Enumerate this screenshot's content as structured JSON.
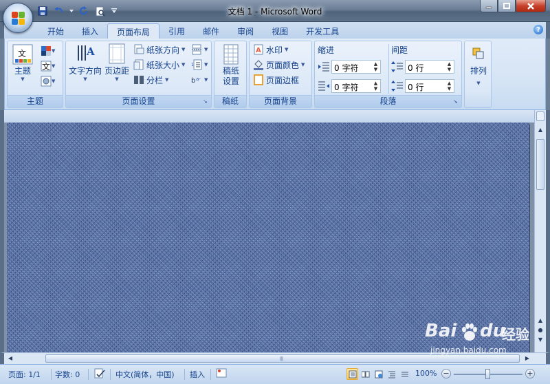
{
  "window": {
    "title": "文档 1 - Microsoft Word"
  },
  "tabs": [
    {
      "label": "开始",
      "active": false
    },
    {
      "label": "插入",
      "active": false
    },
    {
      "label": "页面布局",
      "active": true
    },
    {
      "label": "引用",
      "active": false
    },
    {
      "label": "邮件",
      "active": false
    },
    {
      "label": "审阅",
      "active": false
    },
    {
      "label": "视图",
      "active": false
    },
    {
      "label": "开发工具",
      "active": false
    }
  ],
  "ribbon": {
    "theme_group": {
      "label": "主题",
      "theme_button": "主题"
    },
    "page_setup_group": {
      "label": "页面设置",
      "text_direction": "文字方向",
      "margins": "页边距",
      "orientation": "纸张方向",
      "size": "纸张大小",
      "columns": "分栏"
    },
    "draft_group": {
      "label": "稿纸",
      "button_line1": "稿纸",
      "button_line2": "设置"
    },
    "background_group": {
      "label": "页面背景",
      "watermark": "水印",
      "page_color": "页面颜色",
      "page_borders": "页面边框"
    },
    "paragraph_group": {
      "label": "段落",
      "indent_label": "缩进",
      "spacing_label": "间距",
      "indent_left": "0 字符",
      "indent_right": "0 字符",
      "spacing_before": "0 行",
      "spacing_after": "0 行"
    },
    "arrange_group": {
      "arrange_button": "排列"
    }
  },
  "document": {
    "page_color": "#5a73a6"
  },
  "status": {
    "page": "页面: 1/1",
    "words": "字数: 0",
    "language": "中文(简体，中国)",
    "insert_mode": "插入",
    "zoom": "100%",
    "zoom_minus": "−",
    "zoom_plus": "+"
  },
  "watermark": {
    "brand": "Bai",
    "brand2": "du",
    "product": "经验",
    "url": "jingyan.baidu.com"
  },
  "colors": {
    "accent": "#15428b",
    "ribbon_bg": "#d5e4f5",
    "titlebar": "#5d7189"
  }
}
